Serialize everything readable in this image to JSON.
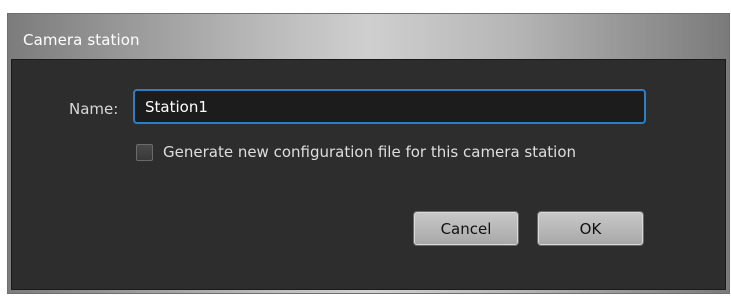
{
  "dialog": {
    "title": "Camera station"
  },
  "form": {
    "name_label": "Name:",
    "name_value": "Station1",
    "generate_checkbox_label": "Generate new configuration file for this camera station",
    "generate_checked": false
  },
  "buttons": {
    "cancel_label": "Cancel",
    "ok_label": "OK"
  }
}
